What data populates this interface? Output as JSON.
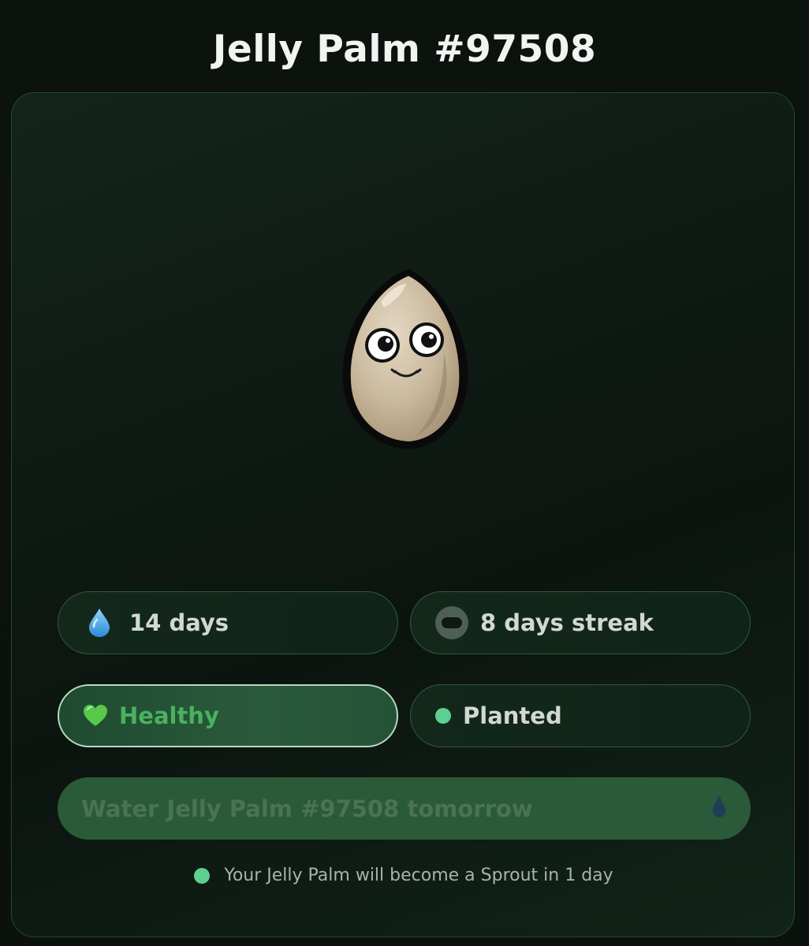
{
  "header": {
    "title": "Jelly Palm #97508"
  },
  "plant": {
    "image_icon": "smiling-seed-illustration"
  },
  "stats": {
    "water_days": "14 days",
    "water_icon": "water-drop-icon",
    "streak": "8 days streak",
    "streak_icon": "streak-badge-icon",
    "health": "Healthy",
    "health_icon": "green-heart-icon",
    "stage": "Planted",
    "stage_icon": "green-dot-icon"
  },
  "action": {
    "label": "Water Jelly Palm #97508 tomorrow",
    "icon": "water-drop-icon",
    "state": "disabled"
  },
  "footer": {
    "note": "Your Jelly Palm will become a Sprout in 1 day"
  },
  "colors": {
    "background": "#0b130e",
    "accent_green": "#5dd08f",
    "health_text": "#49b25e",
    "button_fill": "#2b5a39"
  }
}
